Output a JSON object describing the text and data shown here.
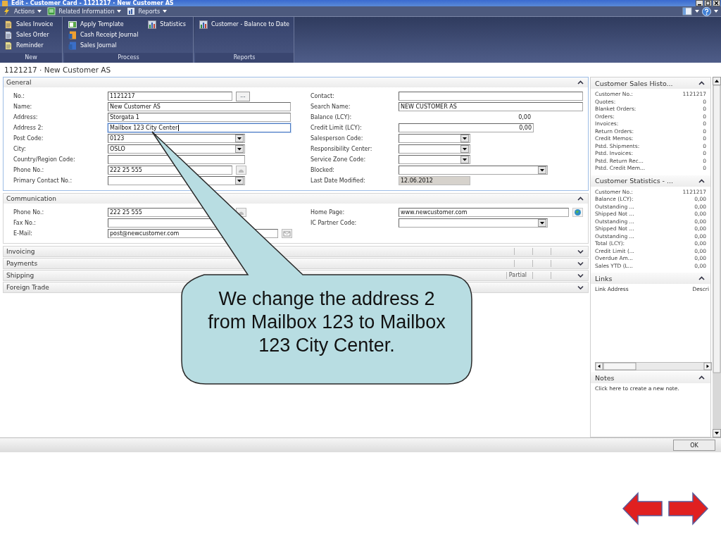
{
  "window": {
    "title": "Edit - Customer Card - 1121217 · New Customer AS"
  },
  "menu": [
    {
      "label": "Actions",
      "kind": "actions"
    },
    {
      "label": "Related Information",
      "kind": "related"
    },
    {
      "label": "Reports",
      "kind": "reports"
    }
  ],
  "ribbon": [
    {
      "label": "New",
      "items": [
        {
          "label": "Sales Invoice"
        },
        {
          "label": "Sales Order"
        },
        {
          "label": "Reminder"
        }
      ]
    },
    {
      "label": "Process",
      "items": [
        {
          "label": "Apply Template"
        },
        {
          "label": "Cash Receipt Journal"
        },
        {
          "label": "Sales Journal"
        },
        {
          "label": "Statistics"
        }
      ]
    },
    {
      "label": "Reports",
      "items": [
        {
          "label": "Customer - Balance to Date"
        }
      ]
    }
  ],
  "page_title": "1121217 · New Customer AS",
  "general": {
    "title": "General",
    "expanded": true,
    "left": [
      {
        "label": "No.:",
        "value": "1121217",
        "kind": "lookup",
        "button_text": "...",
        "focused": false
      },
      {
        "label": "Name:",
        "value": "New Customer AS",
        "kind": "text",
        "focused": false
      },
      {
        "label": "Address:",
        "value": "Storgata 1",
        "kind": "text",
        "focused": false
      },
      {
        "label": "Address 2:",
        "value": "Mailbox 123 City Center",
        "kind": "text",
        "focused": true
      },
      {
        "label": "Post Code:",
        "value": "0123",
        "kind": "dropdown",
        "focused": false
      },
      {
        "label": "City:",
        "value": "OSLO",
        "kind": "dropdown",
        "focused": false
      },
      {
        "label": "Country/Region Code:",
        "kind": "text",
        "focused": false
      },
      {
        "label": "Phone No.:",
        "value": "222 25 555",
        "kind": "phone",
        "focused": false
      },
      {
        "label": "Primary Contact No.:",
        "kind": "dropdown",
        "focused": false
      }
    ],
    "right": [
      {
        "label": "Contact:",
        "kind": "text",
        "focused": false
      },
      {
        "label": "Search Name:",
        "value": "NEW CUSTOMER AS",
        "kind": "text",
        "focused": false
      },
      {
        "label": "Balance (LCY):",
        "value": "0,00",
        "kind": "display"
      },
      {
        "label": "Credit Limit (LCY):",
        "value": "0,00",
        "kind": "amount",
        "focused": false
      },
      {
        "label": "Salesperson Code:",
        "kind": "dropdown",
        "focused": false
      },
      {
        "label": "Responsibility Center:",
        "kind": "dropdown",
        "focused": false
      },
      {
        "label": "Service Zone Code:",
        "kind": "dropdown",
        "focused": false
      },
      {
        "label": "Blocked:",
        "kind": "dropdown",
        "focused": false
      },
      {
        "label": "Last Date Modified:",
        "value": "12.06.2012",
        "kind": "readonly",
        "focused": false
      }
    ]
  },
  "communication": {
    "title": "Communication",
    "expanded": true,
    "left": [
      {
        "label": "Phone No.:",
        "value": "222 25 555",
        "kind": "phone",
        "focused": false
      },
      {
        "label": "Fax No.:",
        "kind": "text",
        "focused": false
      },
      {
        "label": "E-Mail:",
        "value": "post@newcustomer.com",
        "kind": "email",
        "focused": false
      }
    ],
    "right": [
      {
        "label": "Home Page:",
        "value": "www.newcustomer.com",
        "kind": "web",
        "focused": false
      },
      {
        "label": "IC Partner Code:",
        "kind": "dropdown",
        "focused": false
      }
    ]
  },
  "collapsed_tabs": [
    {
      "label": "Invoicing",
      "expanded": false
    },
    {
      "label": "Payments",
      "expanded": false
    },
    {
      "label": "Shipping",
      "expanded": false,
      "summary": "Partial"
    },
    {
      "label": "Foreign Trade",
      "expanded": false
    }
  ],
  "factboxes": [
    {
      "kind": "list",
      "title": "Customer Sales Histo...",
      "expanded": true,
      "rows": [
        {
          "label": "Customer No.:",
          "value": "1121217"
        },
        {
          "label": "Quotes:",
          "value": "0"
        },
        {
          "label": "Blanket Orders:",
          "value": "0"
        },
        {
          "label": "Orders:",
          "value": "0"
        },
        {
          "label": "Invoices:",
          "value": "0"
        },
        {
          "label": "Return Orders:",
          "value": "0"
        },
        {
          "label": "Credit Memos:",
          "value": "0"
        },
        {
          "label": "Pstd. Shipments:",
          "value": "0"
        },
        {
          "label": "Pstd. Invoices:",
          "value": "0"
        },
        {
          "label": "Pstd. Return Rec...",
          "value": "0"
        },
        {
          "label": "Pstd. Credit Mem...",
          "value": "0"
        }
      ]
    },
    {
      "kind": "list",
      "title": "Customer Statistics - ...",
      "expanded": true,
      "rows": [
        {
          "label": "Customer No.:",
          "value": "1121217"
        },
        {
          "label": "Balance (LCY):",
          "value": "0,00"
        },
        {
          "label": "Outstanding ...",
          "value": "0,00"
        },
        {
          "label": "Shipped Not ...",
          "value": "0,00"
        },
        {
          "label": "Outstanding ...",
          "value": "0,00"
        },
        {
          "label": "Shipped Not ...",
          "value": "0,00"
        },
        {
          "label": "Outstanding ...",
          "value": "0,00"
        },
        {
          "label": "Total (LCY):",
          "value": "0,00"
        },
        {
          "label": "Credit Limit (...",
          "value": "0,00"
        },
        {
          "label": "Overdue Am...",
          "value": "0,00"
        },
        {
          "label": "Sales YTD (L...",
          "value": "0,00"
        }
      ]
    },
    {
      "kind": "links",
      "title": "Links",
      "expanded": true,
      "columns": [
        "Link Address",
        "Descri"
      ]
    },
    {
      "kind": "notes",
      "title": "Notes",
      "expanded": true,
      "text": "Click here to create a new note."
    }
  ],
  "ok_button": "OK",
  "callout": {
    "text": "We change the address 2 from Mailbox 123 to Mailbox 123 City Center."
  }
}
